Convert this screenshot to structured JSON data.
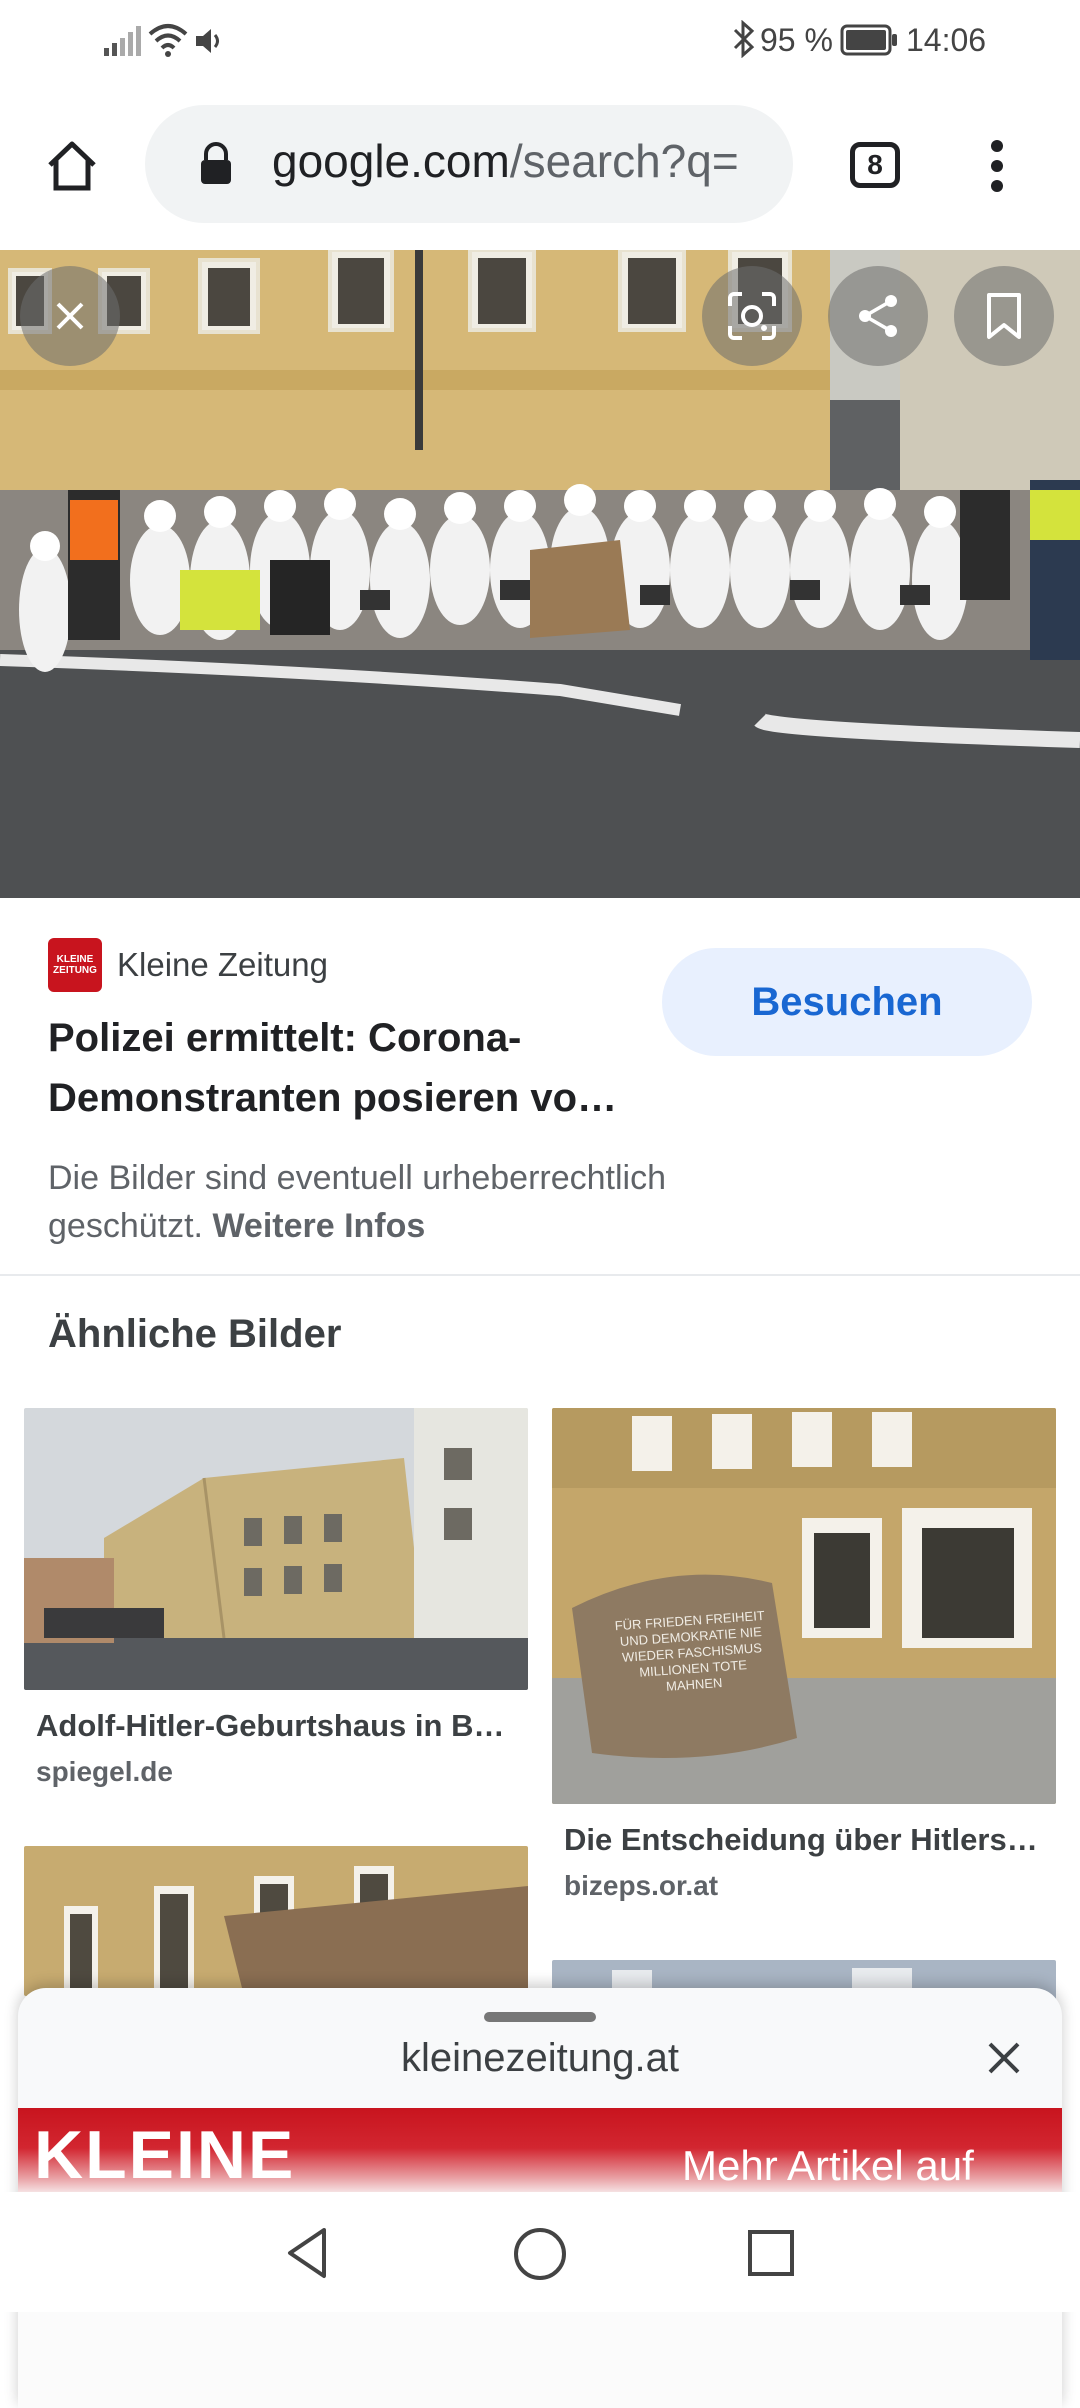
{
  "status_bar": {
    "battery_percent": "95 %",
    "time": "14:06",
    "icons": [
      "signal-icon",
      "wifi-icon",
      "volume-icon",
      "bluetooth-icon",
      "battery-icon"
    ]
  },
  "browser": {
    "url_host": "google.com",
    "url_rest": "/search?q=",
    "tab_count": "8",
    "icons": [
      "home-icon",
      "lock-icon",
      "more-vert-icon"
    ]
  },
  "viewer": {
    "icons": [
      "close-icon",
      "lens-icon",
      "share-icon",
      "bookmark-icon"
    ]
  },
  "result": {
    "source_logo_text": "KLEINE ZEITUNG",
    "source_name": "Kleine Zeitung",
    "visit_label": "Besuchen",
    "headline": "Polizei ermittelt: Corona-Demonstranten posieren vo…",
    "copyright_text": "Die Bilder sind eventuell urheberrechtlich geschützt.",
    "more_info_link": "Weitere Infos"
  },
  "similar": {
    "title": "Ähnliche Bilder",
    "items": [
      {
        "title": "Adolf-Hitler-Geburtshaus in B…",
        "source": "spiegel.de"
      },
      {
        "title": "Die Entscheidung über Hitlers…",
        "source": "bizeps.or.at"
      }
    ],
    "stone_inscription": "FÜR FRIEDEN FREIHEIT UND DEMOKRATIE NIE WIEDER FASCHISMUS MILLIONEN TOTE MAHNEN"
  },
  "sheet": {
    "domain": "kleinezeitung.at",
    "banner_brand": "KLEINE",
    "banner_more": "Mehr Artikel auf"
  },
  "colors": {
    "accent_blue": "#1967d2",
    "visit_bg": "#e8f0fe",
    "brand_red": "#c8141e"
  }
}
